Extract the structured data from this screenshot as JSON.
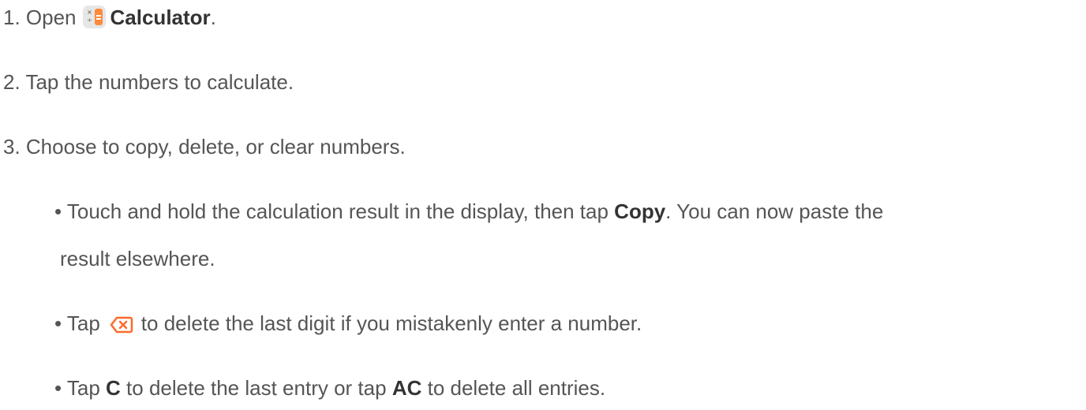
{
  "steps": {
    "step1": {
      "prefix": "1. Open",
      "app_name": "Calculator",
      "suffix": "."
    },
    "step2": {
      "text": "2. Tap the numbers to calculate."
    },
    "step3": {
      "text": "3. Choose to copy, delete, or clear numbers."
    }
  },
  "bullets": {
    "copy": {
      "prefix": "• Touch and hold the calculation result in the display, then tap",
      "action": "Copy",
      "suffix": ". You can now paste the",
      "continuation": "result elsewhere."
    },
    "delete": {
      "prefix": "• Tap",
      "suffix": "to delete the last digit if you mistakenly enter a number."
    },
    "clear": {
      "prefix": "• Tap",
      "key_c": "C",
      "middle": "to delete the last entry or tap",
      "key_ac": "AC",
      "suffix": "to delete all entries."
    }
  },
  "icons": {
    "calculator": "calculator-app-icon",
    "delete": "backspace-icon"
  },
  "colors": {
    "text": "#555555",
    "bold_text": "#333333",
    "calculator_accent": "#ff8a3d",
    "delete_icon": "#ff6a2a"
  }
}
